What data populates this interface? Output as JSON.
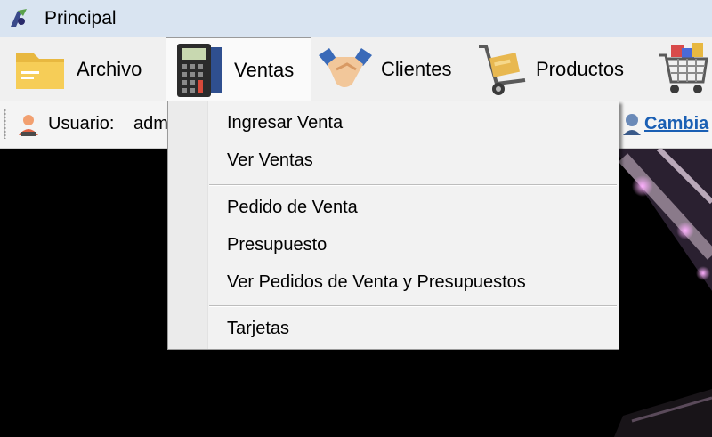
{
  "window": {
    "title": "Principal",
    "icon": "app-icon"
  },
  "menubar": {
    "items": [
      {
        "label": "Archivo",
        "icon": "folder-icon"
      },
      {
        "label": "Ventas",
        "icon": "calculator-icon",
        "active": true
      },
      {
        "label": "Clientes",
        "icon": "handshake-icon"
      },
      {
        "label": "Productos",
        "icon": "hand-truck-icon"
      },
      {
        "label": "",
        "icon": "shopping-cart-icon"
      }
    ]
  },
  "toolbar": {
    "user_label": "Usuario:",
    "user_value": "adm",
    "change_link": "Cambia"
  },
  "dropdown": {
    "items": [
      {
        "label": "Ingresar Venta"
      },
      {
        "label": "Ver Ventas"
      },
      {
        "label": "Pedido de Venta"
      },
      {
        "label": "Presupuesto"
      },
      {
        "label": "Ver Pedidos de Venta y Presupuestos"
      },
      {
        "label": "Tarjetas"
      }
    ]
  },
  "colors": {
    "titlebar": "#d9e4f1",
    "link": "#1a5fb4",
    "background": "#000000",
    "accent_glow": "#e070e0"
  }
}
